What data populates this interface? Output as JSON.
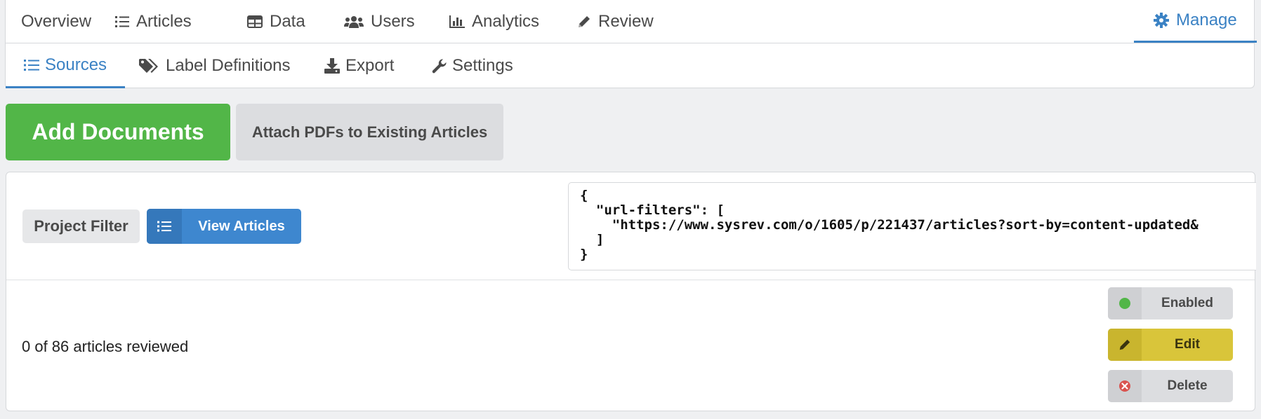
{
  "topnav": {
    "items": [
      {
        "label": "Overview",
        "icon": "none"
      },
      {
        "label": "Articles",
        "icon": "list-icon"
      },
      {
        "label": "Data",
        "icon": "table-icon"
      },
      {
        "label": "Users",
        "icon": "users-icon"
      },
      {
        "label": "Analytics",
        "icon": "chart-icon"
      },
      {
        "label": "Review",
        "icon": "pencil-icon"
      }
    ],
    "manage": {
      "label": "Manage",
      "icon": "gear-icon"
    }
  },
  "subnav": {
    "items": [
      {
        "label": "Sources",
        "icon": "list-icon",
        "active": true
      },
      {
        "label": "Label Definitions",
        "icon": "tags-icon"
      },
      {
        "label": "Export",
        "icon": "download-icon"
      },
      {
        "label": "Settings",
        "icon": "wrench-icon"
      }
    ]
  },
  "buttons": {
    "add_documents": "Add Documents",
    "attach_pdfs": "Attach PDFs to Existing Articles"
  },
  "source": {
    "type_label": "Project Filter",
    "view_articles": "View Articles",
    "code": "{\n  \"url-filters\": [\n    \"https://www.sysrev.com/o/1605/p/221437/articles?sort-by=content-updated&\n  ]\n}",
    "reviewed_text": "0 of 86 articles reviewed",
    "actions": {
      "enabled": "Enabled",
      "edit": "Edit",
      "delete": "Delete"
    }
  },
  "colors": {
    "accent": "#3b82c4",
    "add_green": "#52b648",
    "highlight": "#f7e03c",
    "enabled_dot": "#52b648",
    "delete_red": "#d9534f"
  }
}
